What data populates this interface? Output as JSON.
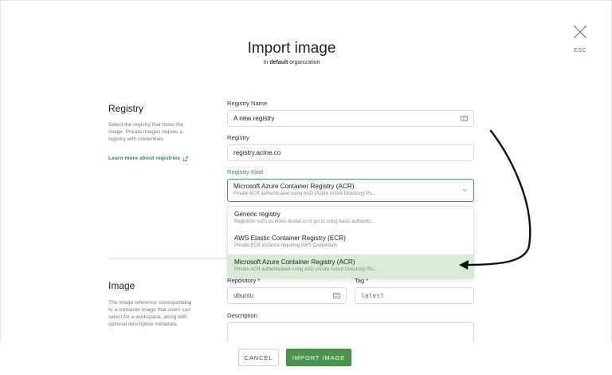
{
  "header": {
    "title": "Import image",
    "subtitle_prefix": "In",
    "subtitle_org": "default",
    "subtitle_suffix": "organization",
    "esc_label": "ESC"
  },
  "registry_section": {
    "title": "Registry",
    "description": "Select the registry that hosts the image. Private images require a registry with credentials.",
    "learn_more": "Learn more about registries"
  },
  "image_section": {
    "title": "Image",
    "description": "The image reference corresponding to a container image that users can select for a workspace, along with optional descriptive metadata."
  },
  "form": {
    "registry_name_label": "Registry Name",
    "registry_name_value": "A new registry",
    "registry_label": "Registry",
    "registry_value": "registry.acme.co",
    "registry_kind_label": "Registry Kind",
    "registry_kind_selected": "Microsoft Azure Container Registry (ACR)",
    "registry_kind_selected_sub": "Private ACR authenticated using AAD (Azure Active Directory) Po...",
    "repository_label": "Repository *",
    "repository_value": "ubuntu",
    "tag_label": "Tag *",
    "tag_placeholder": "latest",
    "description_label": "Description"
  },
  "dropdown": {
    "options": [
      {
        "title": "Generic registry",
        "sub": "Registries such as index.docker.io or gcr.io using basic authentic..."
      },
      {
        "title": "AWS Elastic Container Registry (ECR)",
        "sub": "Private ECR instance requiring AWS Credentials."
      },
      {
        "title": "Microsoft Azure Container Registry (ACR)",
        "sub": "Private ACR authenticated using AAD (Azure Active Directory) Po..."
      }
    ],
    "selected_index": 2
  },
  "footer": {
    "cancel_label": "CANCEL",
    "import_label": "IMPORT IMAGE"
  },
  "colors": {
    "accent": "#4b944f",
    "selected_bg": "#d6ecd4",
    "link": "#3b8a45"
  },
  "icons": [
    "close-icon",
    "external-link-icon",
    "id-card-icon",
    "chevron-down-icon",
    "annotation-arrow"
  ]
}
